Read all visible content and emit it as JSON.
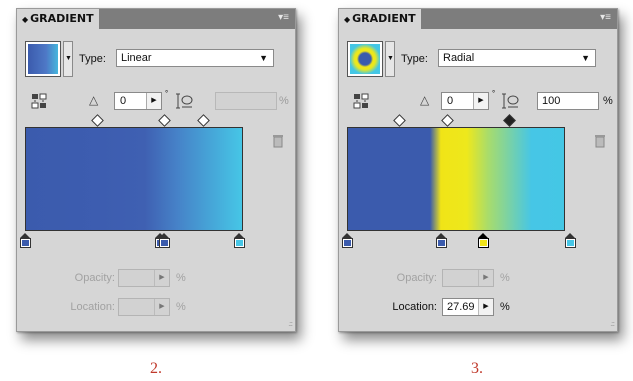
{
  "panels": [
    {
      "title": "GRADIENT",
      "type_label": "Type:",
      "type_value": "Linear",
      "angle": "0",
      "aspect": "",
      "aspect_enabled": false,
      "aspect_unit": "%",
      "swatch_kind": "linear",
      "gradient_stops": [
        "#3b5bad 0%",
        "#3f5fb0 55%",
        "#46c6e6 100%"
      ],
      "stops_colors": [
        "#3b5bad",
        "#3b5bad",
        "#46c6e6"
      ],
      "opacity_label": "Opacity:",
      "opacity_value": "",
      "opacity_unit": "%",
      "location_label": "Location:",
      "location_value": "",
      "location_unit": "%",
      "location_enabled": false,
      "caption": "2."
    },
    {
      "title": "GRADIENT",
      "type_label": "Type:",
      "type_value": "Radial",
      "angle": "0",
      "aspect": "100",
      "aspect_enabled": true,
      "aspect_unit": "%",
      "swatch_kind": "radial",
      "gradient_stops": [
        "#3b5bad 0%",
        "#3b5bad 35%",
        "#f1e718 38%",
        "#e8e820 55%",
        "#44c7e5 100%"
      ],
      "stops_colors": [
        "#3b5bad",
        "#3b5bad",
        "#f0e41a",
        "#46c6e6"
      ],
      "opacity_label": "Opacity:",
      "opacity_value": "",
      "opacity_unit": "%",
      "location_label": "Location:",
      "location_value": "27.69",
      "location_unit": "%",
      "location_enabled": true,
      "caption": "3."
    }
  ],
  "icons": {
    "panel_menu": "panel-menu-icon",
    "reverse": "reverse-gradient-icon",
    "angle": "angle-icon",
    "aspect": "aspect-ratio-icon",
    "trash": "delete-stop-icon"
  }
}
